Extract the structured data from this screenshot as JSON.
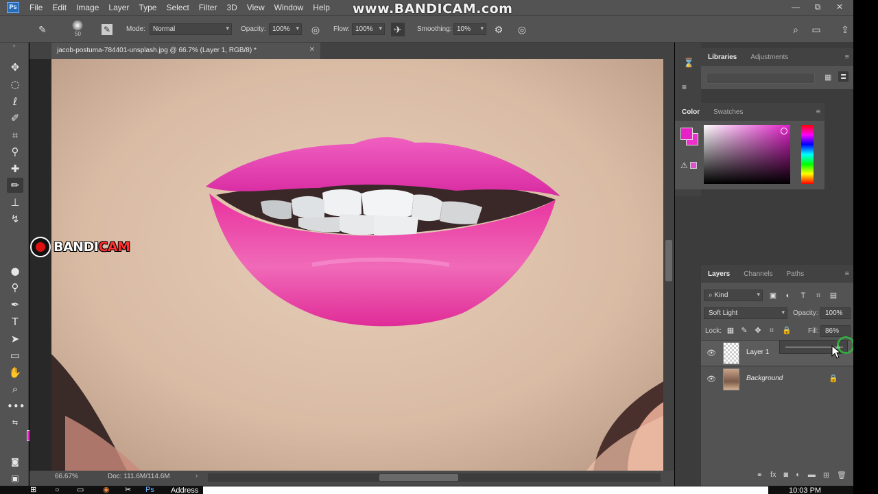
{
  "app": {
    "logo": "Ps",
    "watermark": "www.BANDICAM.com"
  },
  "menu": [
    "File",
    "Edit",
    "Image",
    "Layer",
    "Type",
    "Select",
    "Filter",
    "3D",
    "View",
    "Window",
    "Help"
  ],
  "window_controls": {
    "minimize": "—",
    "restore": "⧉",
    "close": "✕"
  },
  "options_bar": {
    "brush_size": "50",
    "mode_label": "Mode:",
    "mode_value": "Normal",
    "opacity_label": "Opacity:",
    "opacity_value": "100%",
    "flow_label": "Flow:",
    "flow_value": "100%",
    "smoothing_label": "Smoothing:",
    "smoothing_value": "10%"
  },
  "document": {
    "tab_title": "jacob-postuma-784401-unsplash.jpg @ 66.7% (Layer 1, RGB/8) *",
    "zoom": "66.67%",
    "doc_size": "Doc: 111.6M/114.6M"
  },
  "bandicam": {
    "prefix": "BANDI",
    "suffix": "CAM"
  },
  "panels": {
    "libraries_tabs": [
      "Libraries",
      "Adjustments"
    ],
    "color_tabs": [
      "Color",
      "Swatches"
    ],
    "layers_tabs": [
      "Layers",
      "Channels",
      "Paths"
    ]
  },
  "layers": {
    "kind_label": "Kind",
    "blend_mode": "Soft Light",
    "opacity_label": "Opacity:",
    "opacity_value": "100%",
    "lock_label": "Lock:",
    "fill_label": "Fill:",
    "fill_value": "86%",
    "items": [
      {
        "name": "Layer 1",
        "selected": true
      },
      {
        "name": "Background",
        "locked": true
      }
    ]
  },
  "taskbar": {
    "address_label": "Address",
    "clock": "10:03 PM"
  },
  "colors": {
    "foreground": "#e820c8",
    "background": "#ee30cc",
    "lip_color": "#e8309e"
  },
  "icons": [
    "move-icon",
    "marquee-icon",
    "lasso-icon",
    "quick-select-icon",
    "crop-icon",
    "eyedropper-icon",
    "healing-icon",
    "brush-icon",
    "stamp-icon",
    "history-brush-icon",
    "eraser-icon",
    "gradient-icon",
    "blur-icon",
    "dodge-icon",
    "pen-icon",
    "type-icon",
    "path-select-icon",
    "rectangle-icon",
    "hand-icon",
    "zoom-icon",
    "more-icon"
  ]
}
